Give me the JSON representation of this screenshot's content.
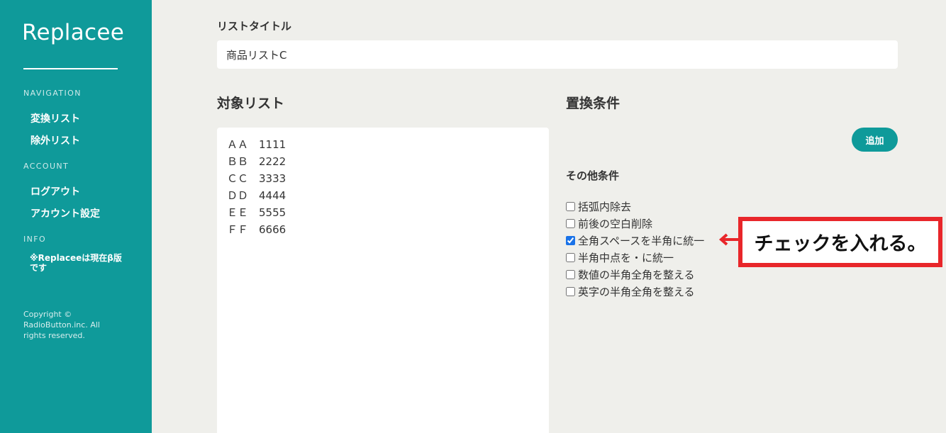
{
  "sidebar": {
    "brand": "Replacee",
    "navigation_label": "NAVIGATION",
    "nav_items": [
      "変換リスト",
      "除外リスト"
    ],
    "account_label": "ACCOUNT",
    "account_items": [
      "ログアウト",
      "アカウント設定"
    ],
    "info_label": "INFO",
    "info_note": "※Replaceeは現在β版です",
    "copyright": "Copyright © RadioButton.inc. All rights reserved."
  },
  "form": {
    "list_title_label": "リストタイトル",
    "list_title_value": "商品リストC",
    "target_list_heading": "対象リスト",
    "target_list_value": "ＡＡ　1111\nＢＢ　2222\nＣＣ　3333\nＤＤ　4444\nＥＥ　5555\nＦＦ　6666",
    "replace_conditions_heading": "置換条件",
    "add_button_label": "追加",
    "other_conditions_heading": "その他条件",
    "options": [
      {
        "label": "括弧内除去",
        "checked": false
      },
      {
        "label": "前後の空白削除",
        "checked": false
      },
      {
        "label": "全角スペースを半角に統一",
        "checked": true
      },
      {
        "label": "半角中点を・に統一",
        "checked": false
      },
      {
        "label": "数値の半角全角を整える",
        "checked": false
      },
      {
        "label": "英字の半角全角を整える",
        "checked": false
      }
    ]
  },
  "annotation": {
    "text": "チェックを入れる。",
    "color": "#e8262a"
  },
  "colors": {
    "accent": "#0f9a9a",
    "background": "#efefeb"
  }
}
